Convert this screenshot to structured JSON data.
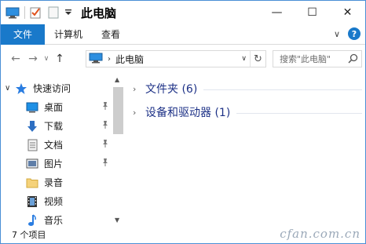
{
  "window": {
    "title": "此电脑",
    "controls": {
      "minimize": "—",
      "maximize": "☐",
      "close": "✕"
    }
  },
  "quick_access_toolbar": {
    "items": [
      "computer-icon",
      "properties-check-icon",
      "new-folder-icon",
      "customize-dropdown-icon"
    ]
  },
  "ribbon": {
    "file_tab": "文件",
    "tabs": [
      "计算机",
      "查看"
    ],
    "collapse_chevron": "∨",
    "help": "?",
    "accent": "#1979ca"
  },
  "address_bar": {
    "back": "←",
    "forward": "→",
    "recent": "∨",
    "up": "↑",
    "breadcrumb": "此电脑",
    "separator": "›",
    "dropdown": "∨",
    "refresh": "↻"
  },
  "search": {
    "placeholder": "搜索\"此电脑\""
  },
  "nav_pane": {
    "quick_access": {
      "label": "快速访问",
      "icon": "star-icon"
    },
    "items": [
      {
        "label": "桌面",
        "icon": "desktop-icon",
        "pinned": true
      },
      {
        "label": "下载",
        "icon": "download-arrow-icon",
        "pinned": true
      },
      {
        "label": "文档",
        "icon": "document-icon",
        "pinned": true
      },
      {
        "label": "图片",
        "icon": "pictures-icon",
        "pinned": true
      },
      {
        "label": "录音",
        "icon": "folder-icon",
        "pinned": false
      },
      {
        "label": "视频",
        "icon": "film-icon",
        "pinned": false
      },
      {
        "label": "音乐",
        "icon": "music-note-icon",
        "pinned": false
      }
    ]
  },
  "content": {
    "groups": [
      {
        "label": "文件夹 (6)",
        "chevron": "›"
      },
      {
        "label": "设备和驱动器 (1)",
        "chevron": "›"
      }
    ],
    "group_label_color": "#1e3287"
  },
  "status_bar": {
    "item_count": "7 个项目",
    "watermark": "cfan.com.cn"
  }
}
